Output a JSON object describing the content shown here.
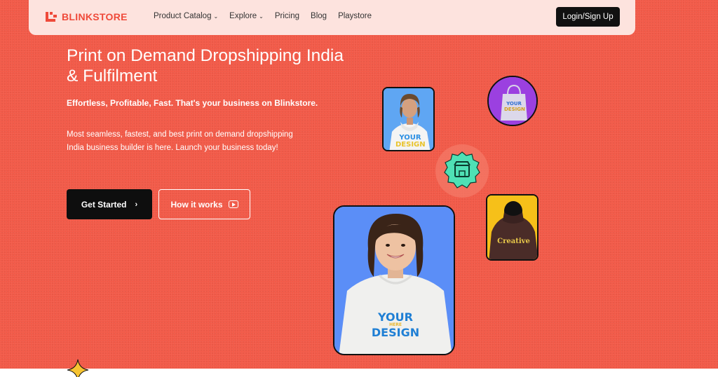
{
  "nav": {
    "logo_text": "BLINKSTORE",
    "items": [
      {
        "label": "Product Catalog",
        "dropdown": true
      },
      {
        "label": "Explore",
        "dropdown": true
      },
      {
        "label": "Pricing",
        "dropdown": false
      },
      {
        "label": "Blog",
        "dropdown": false
      },
      {
        "label": "Playstore",
        "dropdown": false
      }
    ],
    "login_label": "Login/Sign Up"
  },
  "hero": {
    "title": "Print on Demand Dropshipping India & Fulfilment",
    "tagline": "Effortless, Profitable, Fast. That's your business on Blinkstore.",
    "description": "Most seamless, fastest, and best print on demand dropshipping India business builder is here. Launch your business today!",
    "get_started_label": "Get Started",
    "how_it_works_label": "How it works"
  },
  "images": {
    "man_shirt_text": [
      "YOUR",
      "DESIGN"
    ],
    "bag_text": [
      "YOUR",
      "DESIGN"
    ],
    "woman_shirt_text": [
      "YOUR",
      "HERE",
      "DESIGN"
    ],
    "hoodie_text": "Creative"
  },
  "colors": {
    "hero_bg": "#f25a48",
    "nav_bg": "#fde3de",
    "brand": "#ef4a3a",
    "badge": "#4fe0b5"
  },
  "icons": [
    "logo-icon",
    "chevron-down-icon",
    "chevron-right-icon",
    "play-icon",
    "store-icon",
    "sparkle-icon"
  ]
}
